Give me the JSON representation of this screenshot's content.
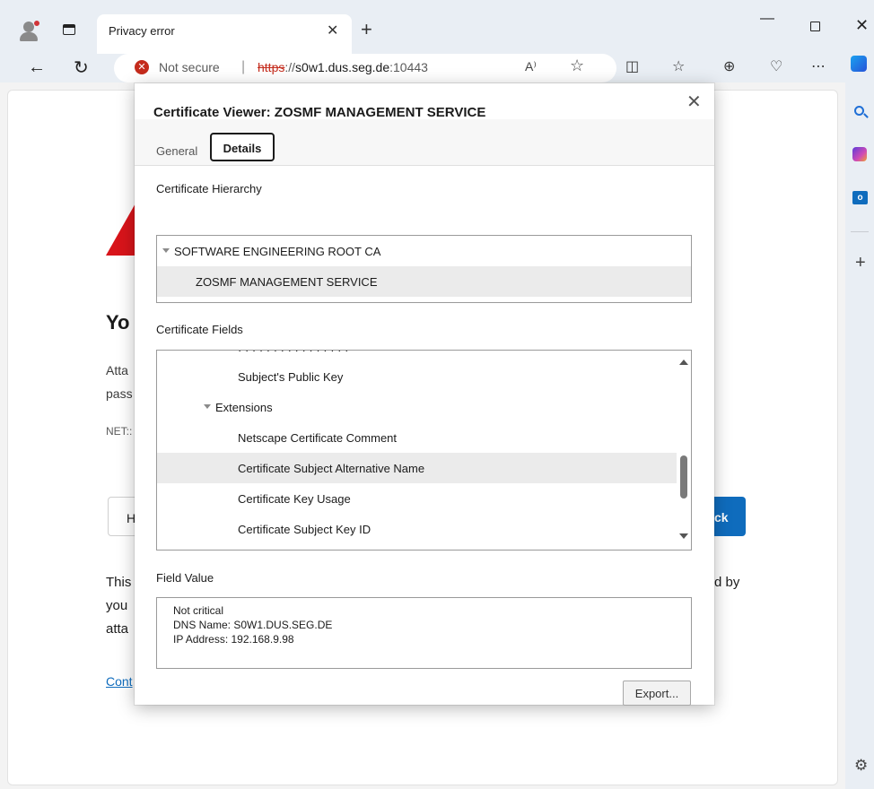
{
  "browser": {
    "tab_title": "Privacy error",
    "address": {
      "security_label": "Not secure",
      "separator": "|",
      "url_scheme": "https",
      "url_rest_prefix": "://",
      "url_host": "s0w1.dus.seg.de",
      "url_port": ":10443"
    },
    "read_aloud_glyph": "A⁾",
    "more_glyph": "⋯"
  },
  "page": {
    "heading_partial": "Yo",
    "para1_line1_partial": "Atta",
    "para1_line2_partial": "pass",
    "error_code_partial": "NET::",
    "advanced_button_partial": "H",
    "back_button_partial": "ck",
    "para2_line1_partial": "This",
    "para2_line2_partial": "you",
    "para2_line3_partial": "atta",
    "para2_right_partial": "d by",
    "continue_link_partial": "Cont"
  },
  "dialog": {
    "title": "Certificate Viewer: ZOSMF MANAGEMENT SERVICE",
    "tabs": {
      "general": "General",
      "details": "Details"
    },
    "hierarchy_label": "Certificate Hierarchy",
    "hierarchy": {
      "root": "SOFTWARE ENGINEERING ROOT CA",
      "child": "ZOSMF MANAGEMENT SERVICE"
    },
    "fields_label": "Certificate Fields",
    "fields": [
      "Subject's Public Key",
      "Extensions",
      "Netscape Certificate Comment",
      "Certificate Subject Alternative Name",
      "Certificate Key Usage",
      "Certificate Subject Key ID"
    ],
    "field_value_label": "Field Value",
    "field_value_lines": [
      "Not critical",
      "DNS Name: S0W1.DUS.SEG.DE",
      "IP Address: 192.168.9.98"
    ],
    "export_label": "Export..."
  },
  "colors": {
    "accent": "#0f6cbd",
    "error": "#c42b1c",
    "chrome": "#e9eef4",
    "selected_row": "#ebebeb"
  },
  "icons": [
    "profile-icon",
    "tab-actions-icon",
    "close-icon",
    "new-tab-icon",
    "minimize-icon",
    "maximize-icon",
    "back-icon",
    "reload-icon",
    "error-x-icon",
    "read-aloud-icon",
    "favorite-star-icon",
    "split-screen-icon",
    "favorites-icon",
    "collections-icon",
    "browser-essentials-icon",
    "more-icon",
    "copilot-icon",
    "search-icon",
    "copilot-hex-icon",
    "outlook-icon",
    "add-icon",
    "settings-gear-icon",
    "warning-triangle-icon",
    "triangle-down-icon",
    "scroll-up-icon",
    "scroll-down-icon"
  ]
}
